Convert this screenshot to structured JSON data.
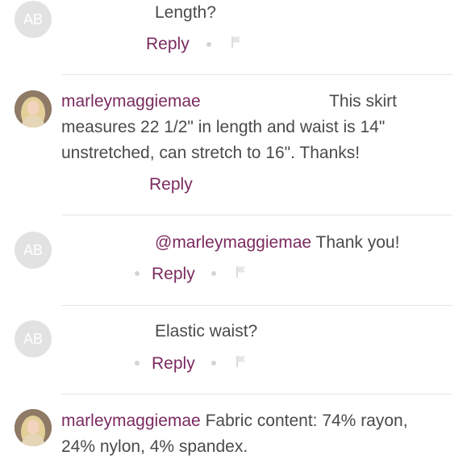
{
  "comments": [
    {
      "avatar_initials": "AB",
      "text_lines": [
        "Length?"
      ],
      "reply_label": "Reply"
    },
    {
      "username": "marleymaggiemae",
      "text_lines": [
        "This skirt",
        "measures 22 1/2\" in length and waist is 14\"",
        "unstretched, can stretch to 16\".  Thanks!"
      ],
      "reply_label": "Reply"
    },
    {
      "avatar_initials": "AB",
      "mention": "@marleymaggiemae",
      "text_lines": [
        "Thank you!"
      ],
      "reply_label": "Reply"
    },
    {
      "avatar_initials": "AB",
      "text_lines": [
        "Elastic waist?"
      ],
      "reply_label": "Reply"
    },
    {
      "username": "marleymaggiemae",
      "text_lines": [
        "Fabric content: 74% rayon,",
        "24% nylon, 4% spandex."
      ]
    }
  ],
  "colors": {
    "username": "#7b2a5f",
    "reply": "#7b2a5f",
    "text": "#4a4a4a",
    "avatar_bg": "#e2e2e2",
    "divider": "#e6e6e6"
  }
}
